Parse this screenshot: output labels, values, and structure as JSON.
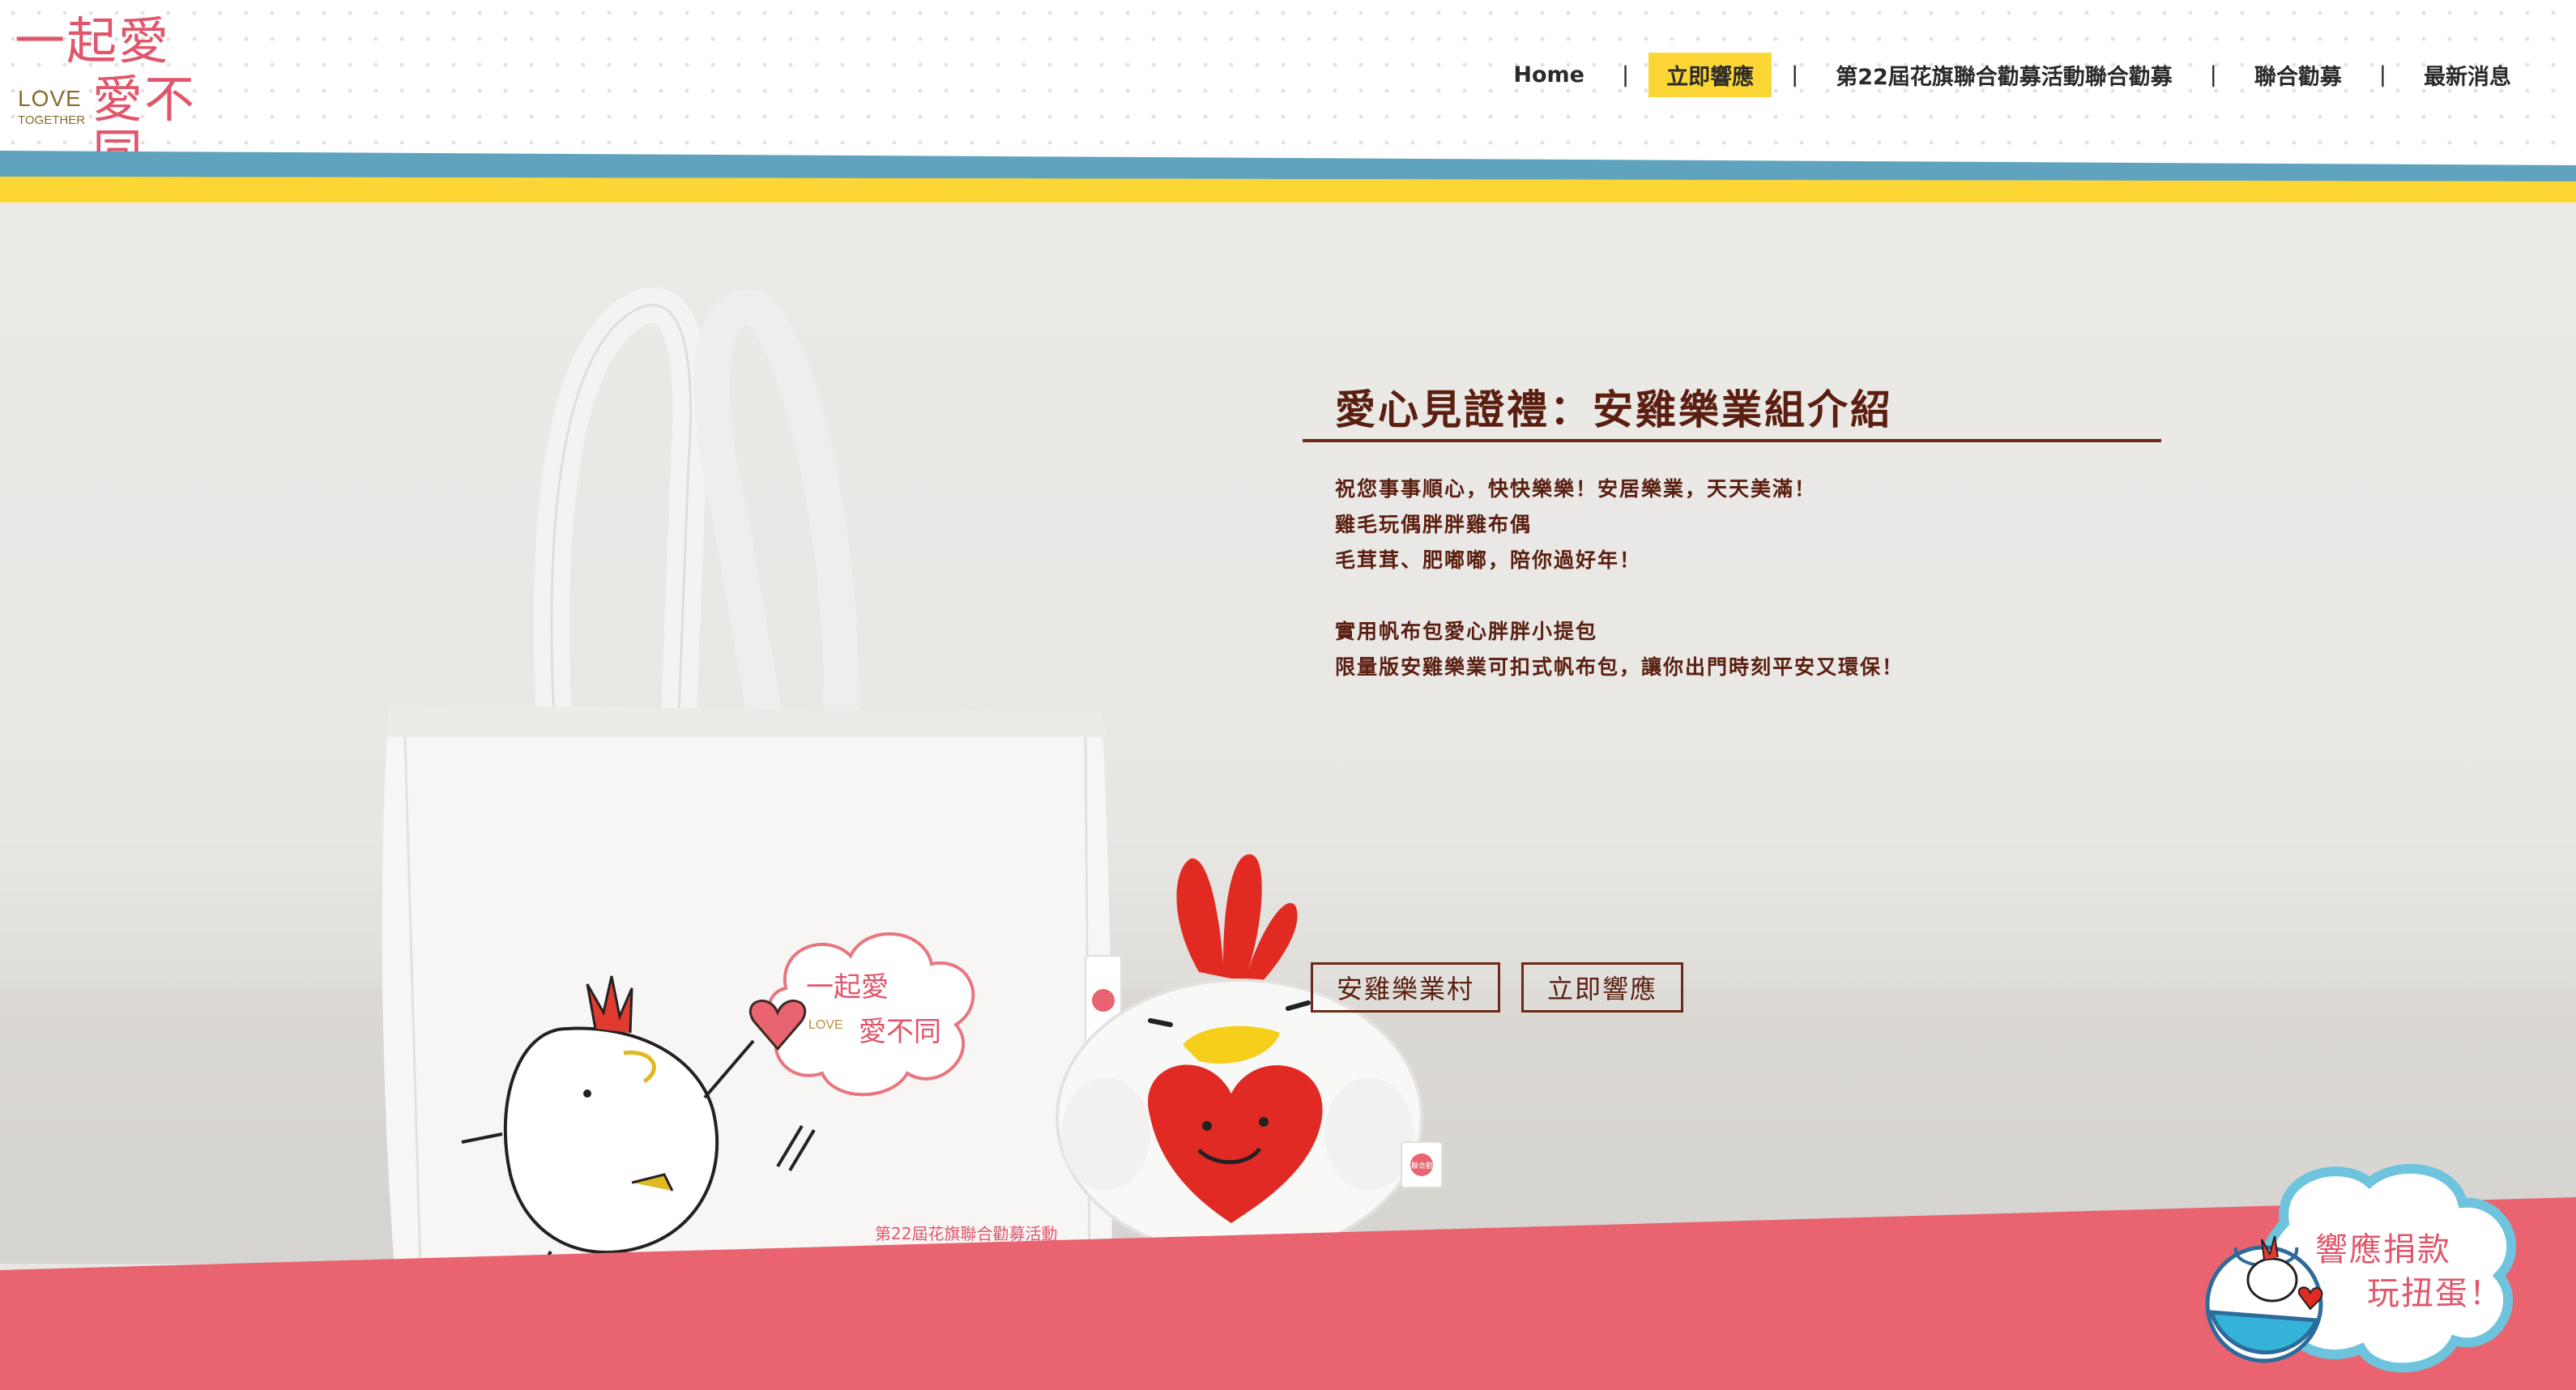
{
  "logo": {
    "line1": "一起愛",
    "line2": "愛不同",
    "love": "LOVE",
    "together": "TOGETHER"
  },
  "nav": {
    "items": [
      {
        "label": "Home",
        "active": false
      },
      {
        "label": "立即響應",
        "active": true
      },
      {
        "label": "第22屆花旗聯合勸募活動聯合勸募",
        "active": false
      },
      {
        "label": "聯合勸募",
        "active": false
      },
      {
        "label": "最新消息",
        "active": false
      }
    ],
    "separator": "|"
  },
  "hero": {
    "title": "愛心見證禮：安雞樂業組介紹",
    "lines": [
      "祝您事事順心，快快樂樂！安居樂業，天天美滿！",
      "雞毛玩偶胖胖雞布偶",
      "毛茸茸、肥嘟嘟，陪你過好年！",
      "",
      "實用帆布包愛心胖胖小提包",
      "限量版安雞樂業可扣式帆布包，讓你出門時刻平安又環保！"
    ],
    "buttons": {
      "village": "安雞樂業村",
      "respond": "立即響應"
    },
    "bag_print": {
      "cloud_line1": "一起愛",
      "cloud_line2": "愛不同",
      "cloud_love": "LOVE",
      "caption": "第22屆花旗聯合勸募活動"
    },
    "tag_text": "聯合勸募"
  },
  "game": {
    "line1": "響應捐款",
    "line2": "玩扭蛋！"
  },
  "colors": {
    "brand_pink": "#e0566b",
    "nav_active": "#fcd634",
    "stripe_blue": "#5fa3be",
    "stripe_yellow": "#fcd634",
    "title_brown": "#5a1f10",
    "band_pink": "#e96370"
  }
}
